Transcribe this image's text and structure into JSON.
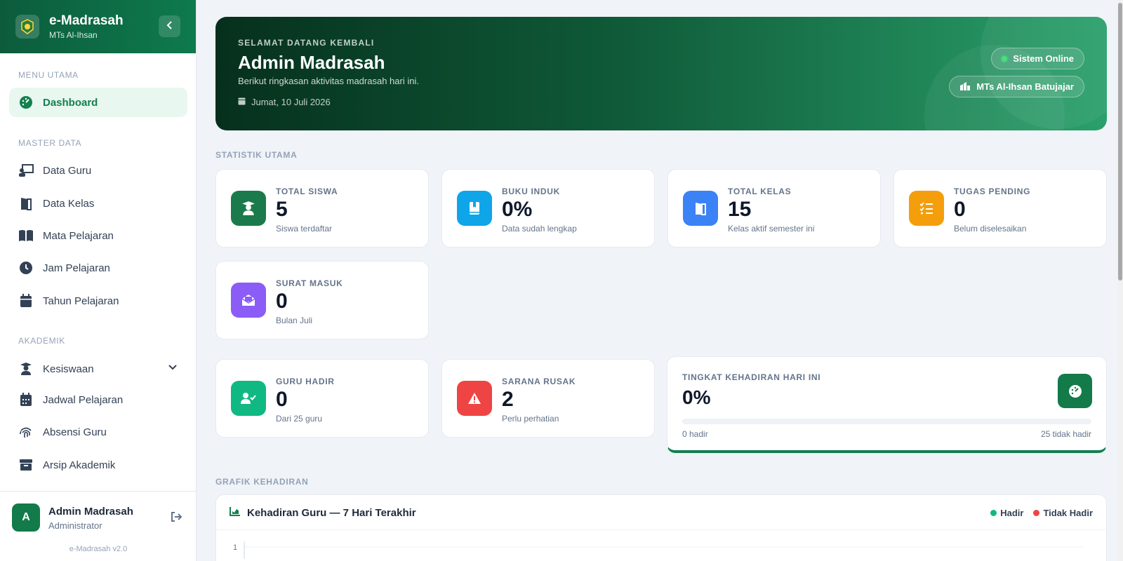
{
  "sidebar": {
    "brand": "e-Madrasah",
    "school": "MTs Al-Ihsan",
    "sections": {
      "main": "MENU UTAMA",
      "master": "MASTER DATA",
      "academic": "AKADEMIK"
    },
    "items": {
      "dashboard": {
        "label": "Dashboard",
        "icon": "dashboard-gauge-icon"
      },
      "data_guru": {
        "label": "Data Guru",
        "icon": "teacher-board-icon"
      },
      "data_kelas": {
        "label": "Data Kelas",
        "icon": "door-icon"
      },
      "mata_pelajaran": {
        "label": "Mata Pelajaran",
        "icon": "book-open-icon"
      },
      "jam_pelajaran": {
        "label": "Jam Pelajaran",
        "icon": "clock-icon"
      },
      "tahun_pelajaran": {
        "label": "Tahun Pelajaran",
        "icon": "calendar-icon"
      },
      "kesiswaan": {
        "label": "Kesiswaan",
        "icon": "student-icon"
      },
      "jadwal_pelajaran": {
        "label": "Jadwal Pelajaran",
        "icon": "calendar-grid-icon"
      },
      "absensi_guru": {
        "label": "Absensi Guru",
        "icon": "fingerprint-icon"
      },
      "arsip_akademik": {
        "label": "Arsip Akademik",
        "icon": "archive-icon"
      }
    },
    "user": {
      "initial": "A",
      "name": "Admin Madrasah",
      "role": "Administrator"
    },
    "version": "e-Madrasah v2.0"
  },
  "hero": {
    "kicker": "SELAMAT DATANG KEMBALI",
    "title": "Admin Madrasah",
    "subtitle": "Berikut ringkasan aktivitas madrasah hari ini.",
    "date": "Jumat, 10 Juli 2026",
    "status": "Sistem Online",
    "school_full": "MTs Al-Ihsan Batujajar"
  },
  "stats_label": "STATISTIK UTAMA",
  "stats": {
    "total_siswa": {
      "label": "TOTAL SISWA",
      "value": "5",
      "desc": "Siswa terdaftar",
      "color": "#1b7a4b"
    },
    "buku_induk": {
      "label": "BUKU INDUK",
      "value": "0%",
      "desc": "Data sudah lengkap",
      "color": "#0ea5e9"
    },
    "total_kelas": {
      "label": "TOTAL KELAS",
      "value": "15",
      "desc": "Kelas aktif semester ini",
      "color": "#3b82f6"
    },
    "tugas_pending": {
      "label": "TUGAS PENDING",
      "value": "0",
      "desc": "Belum diselesaikan",
      "color": "#f59e0b"
    },
    "surat_masuk": {
      "label": "SURAT MASUK",
      "value": "0",
      "desc": "Bulan Juli",
      "color": "#8b5cf6"
    },
    "guru_hadir": {
      "label": "GURU HADIR",
      "value": "0",
      "desc": "Dari 25 guru",
      "color": "#10b981"
    },
    "sarana_rusak": {
      "label": "SARANA RUSAK",
      "value": "2",
      "desc": "Perlu perhatian",
      "color": "#ef4444"
    }
  },
  "attendance": {
    "label": "TINGKAT KEHADIRAN HARI INI",
    "value": "0%",
    "progress": 0,
    "present": "0 hadir",
    "absent": "25 tidak hadir"
  },
  "chart_section_label": "GRAFIK KEHADIRAN",
  "chart_data": {
    "type": "line",
    "title": "Kehadiran Guru — 7 Hari Terakhir",
    "legend": [
      {
        "name": "Hadir",
        "color": "#10b981"
      },
      {
        "name": "Tidak Hadir",
        "color": "#ef4444"
      }
    ],
    "legend_placement": "top-right",
    "y_ticks": [
      "1"
    ],
    "grid": true
  }
}
